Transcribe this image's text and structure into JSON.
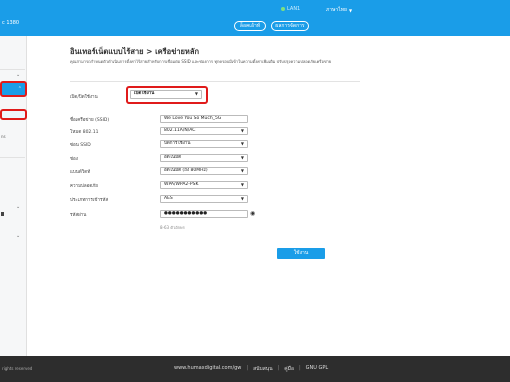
{
  "header": {
    "model_text": "c 1380",
    "lan_label": "LAN1",
    "language_label": "ภาษาไทย",
    "logout_label": "ล็อคเอ้าท์",
    "admin_label": "ผลการจัดการ",
    "accent_color": "#1a9de8",
    "highlight_color": "#e01b1b"
  },
  "sidebar": {
    "small_text": "ns"
  },
  "main": {
    "title": "อินเทอร์เน็ตแบบไร้สาย > เครือข่ายหลัก",
    "description": "คุณสามารถกำหนดตัวดำเนินการตั้งค่าไร้สายสำหรับการเชื่อมต่อ SSID และช่องการ ทุกครอบมีเข้าในความตั้งค่าเพิ่มเติม ปรับปรุงความปลอดภัยเครือข่าย",
    "fields": [
      {
        "label": "เปิด/ปิดใช้งาน",
        "value": "เปิดใช้งาน",
        "type": "select"
      },
      {
        "label": "ชื่อเครือข่าย (SSID)",
        "value": "We Love You So Much_5G",
        "type": "text"
      },
      {
        "label": "โหมด 802.11",
        "value": "802.11A/N/AC",
        "type": "select"
      },
      {
        "label": "ซ่อน SSID",
        "value": "ปิดการใช้งาน",
        "type": "select"
      },
      {
        "label": "ช่อง",
        "value": "อัตโนมัติ",
        "type": "select"
      },
      {
        "label": "แบนด์วิดท์",
        "value": "อัตโนมัติ (ถึง 80MHz)",
        "type": "select"
      },
      {
        "label": "ความปลอดภัย",
        "value": "WPA/WPA2-PSK",
        "type": "select"
      },
      {
        "label": "ประเภทการเข้ารหัส",
        "value": "AES",
        "type": "select"
      },
      {
        "label": "รหัสผ่าน",
        "value": "●●●●●●●●●●●",
        "type": "password"
      }
    ],
    "hint": "8-63 ตัวอักษร",
    "save_label": "ใช้งาน"
  },
  "footer": {
    "copyright": "rights reserved",
    "links": [
      "www.humaxdigital.com/gw",
      "สนับสนุน",
      "คู่มือ",
      "GNU GPL"
    ]
  }
}
